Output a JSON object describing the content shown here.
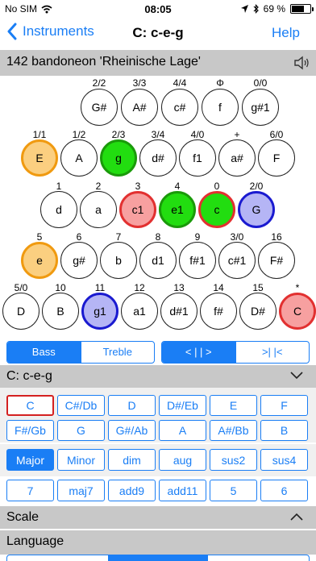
{
  "status": {
    "carrier": "No SIM",
    "time": "08:05",
    "battery": "69 %",
    "battery_level": 0.69
  },
  "nav": {
    "back_label": "Instruments",
    "title": "C: c-e-g",
    "help_label": "Help"
  },
  "instrument": {
    "name": "142 bandoneon 'Rheinische Lage'",
    "speaker_icon": "speaker-icon"
  },
  "keyboard": {
    "rows": [
      {
        "keys": [
          {
            "label": "2/2",
            "note": "G#",
            "style": "plain"
          },
          {
            "label": "3/3",
            "note": "A#",
            "style": "plain"
          },
          {
            "label": "4/4",
            "note": "c#",
            "style": "plain"
          },
          {
            "label": "Φ",
            "note": "f",
            "style": "plain"
          },
          {
            "label": "0/0",
            "note": "g#1",
            "style": "plain"
          }
        ]
      },
      {
        "keys": [
          {
            "label": "1/1",
            "note": "E",
            "style": "orange"
          },
          {
            "label": "1/2",
            "note": "A",
            "style": "plain"
          },
          {
            "label": "2/3",
            "note": "g",
            "style": "green"
          },
          {
            "label": "3/4",
            "note": "d#",
            "style": "plain"
          },
          {
            "label": "4/0",
            "note": "f1",
            "style": "plain"
          },
          {
            "label": "+",
            "note": "a#",
            "style": "plain"
          },
          {
            "label": "6/0",
            "note": "F",
            "style": "plain"
          }
        ]
      },
      {
        "keys": [
          {
            "label": "1",
            "note": "d",
            "style": "plain"
          },
          {
            "label": "2",
            "note": "a",
            "style": "plain"
          },
          {
            "label": "3",
            "note": "c1",
            "style": "red"
          },
          {
            "label": "4",
            "note": "e1",
            "style": "green"
          },
          {
            "label": "0",
            "note": "c",
            "style": "green2"
          },
          {
            "label": "2/0",
            "note": "G",
            "style": "blue"
          }
        ]
      },
      {
        "keys": [
          {
            "label": "5",
            "note": "e",
            "style": "orange"
          },
          {
            "label": "6",
            "note": "g#",
            "style": "plain"
          },
          {
            "label": "7",
            "note": "b",
            "style": "plain"
          },
          {
            "label": "8",
            "note": "d1",
            "style": "plain"
          },
          {
            "label": "9",
            "note": "f#1",
            "style": "plain"
          },
          {
            "label": "3/0",
            "note": "c#1",
            "style": "plain"
          },
          {
            "label": "16",
            "note": "F#",
            "style": "plain"
          }
        ]
      },
      {
        "keys": [
          {
            "label": "5/0",
            "note": "D",
            "style": "plain"
          },
          {
            "label": "10",
            "note": "B",
            "style": "plain"
          },
          {
            "label": "11",
            "note": "g1",
            "style": "blue"
          },
          {
            "label": "12",
            "note": "a1",
            "style": "plain"
          },
          {
            "label": "13",
            "note": "d#1",
            "style": "plain"
          },
          {
            "label": "14",
            "note": "f#",
            "style": "plain"
          },
          {
            "label": "15",
            "note": "D#",
            "style": "plain"
          },
          {
            "label": "*",
            "note": "C",
            "style": "red"
          }
        ]
      }
    ]
  },
  "side_toggle": {
    "options": [
      "Bass",
      "Treble"
    ],
    "selected": 0
  },
  "direction_toggle": {
    "options": [
      "< | | >",
      ">| |<"
    ],
    "selected": 0
  },
  "chord_section": {
    "title": "C: c-e-g"
  },
  "roots": [
    "C",
    "C#/Db",
    "D",
    "D#/Eb",
    "E",
    "F",
    "F#/Gb",
    "G",
    "G#/Ab",
    "A",
    "A#/Bb",
    "B"
  ],
  "root_selected": 0,
  "qualities": [
    "Major",
    "Minor",
    "dim",
    "aug",
    "sus2",
    "sus4"
  ],
  "quality_selected": 0,
  "extensions": [
    "7",
    "maj7",
    "add9",
    "add11",
    "5",
    "6"
  ],
  "scale_section": {
    "title": "Scale"
  },
  "language_section": {
    "title": "Language"
  },
  "colors": {
    "accent": "#1a7ef5",
    "section_bg": "#c8c8c8"
  }
}
